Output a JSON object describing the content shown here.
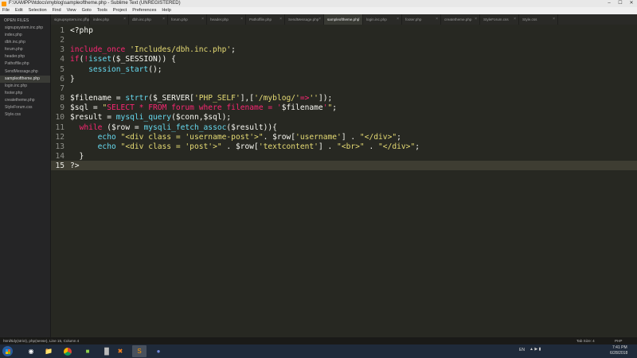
{
  "window": {
    "title": "F:\\XAMPP\\htdocs\\myblog\\sampleoftheme.php - Sublime Text (UNREGISTERED)"
  },
  "menu": [
    "File",
    "Edit",
    "Selection",
    "Find",
    "View",
    "Goto",
    "Tools",
    "Project",
    "Preferences",
    "Help"
  ],
  "sidebar": {
    "header": "OPEN FILES",
    "files": [
      "signupsystem.inc.php",
      "index.php",
      "dbh.inc.php",
      "forum.php",
      "header.php",
      "Pathoffile.php",
      "SendMessage.php",
      "sampleoftheme.php",
      "login.inc.php",
      "footer.php",
      "createtheme.php",
      "StyleForum.css",
      "Style.css"
    ],
    "active_index": 7
  },
  "tabs": [
    "signupsystem.inc.php",
    "index.php",
    "dbh.inc.php",
    "forum.php",
    "header.php",
    "Pathoffile.php",
    "SendMessage.php",
    "sampleoftheme.php",
    "login.inc.php",
    "footer.php",
    "createtheme.php",
    "StyleForum.css",
    "Style.css"
  ],
  "active_tab": 7,
  "editor": {
    "current_line": 15,
    "lines": [
      [
        [
          "<?php",
          "v"
        ]
      ],
      [],
      [
        [
          "include_once",
          "k"
        ],
        [
          " ",
          "v"
        ],
        [
          "'Includes/dbh.inc.php'",
          "s"
        ],
        [
          ";",
          "v"
        ]
      ],
      [
        [
          "if",
          "k"
        ],
        [
          "(",
          "v"
        ],
        [
          "!",
          "k"
        ],
        [
          "isset",
          "f"
        ],
        [
          "($_SESSION)) {",
          "v"
        ]
      ],
      [
        [
          "    ",
          "v"
        ],
        [
          "session_start",
          "f"
        ],
        [
          "();",
          "v"
        ]
      ],
      [
        [
          "}",
          "v"
        ]
      ],
      [],
      [
        [
          "$filename = ",
          "v"
        ],
        [
          "strtr",
          "f"
        ],
        [
          "($_SERVER[",
          "v"
        ],
        [
          "'PHP_SELF'",
          "s"
        ],
        [
          "],[",
          "v"
        ],
        [
          "'/myblog/'",
          "s"
        ],
        [
          "=>",
          "k"
        ],
        [
          "''",
          "s"
        ],
        [
          "]);",
          "v"
        ]
      ],
      [
        [
          "$sql = ",
          "v"
        ],
        [
          "\"",
          "s"
        ],
        [
          "SELECT * FROM forum where filename = '",
          "k"
        ],
        [
          "$filename",
          "v"
        ],
        [
          "'",
          "k"
        ],
        [
          "\"",
          "s"
        ],
        [
          ";",
          "v"
        ]
      ],
      [
        [
          "$result = ",
          "v"
        ],
        [
          "mysqli_query",
          "f"
        ],
        [
          "($conn,$sql);",
          "v"
        ]
      ],
      [
        [
          "  ",
          "v"
        ],
        [
          "while",
          "k"
        ],
        [
          " ($row = ",
          "v"
        ],
        [
          "mysqli_fetch_assoc",
          "f"
        ],
        [
          "($result)){",
          "v"
        ]
      ],
      [
        [
          "      ",
          "v"
        ],
        [
          "echo",
          "f"
        ],
        [
          " ",
          "v"
        ],
        [
          "\"<div class = 'username-post'>\"",
          "s"
        ],
        [
          ". $row[",
          "v"
        ],
        [
          "'username'",
          "s"
        ],
        [
          "] . ",
          "v"
        ],
        [
          "\"</div>\"",
          "s"
        ],
        [
          ";",
          "v"
        ]
      ],
      [
        [
          "      ",
          "v"
        ],
        [
          "echo",
          "f"
        ],
        [
          " ",
          "v"
        ],
        [
          "\"<div class = 'post'>\"",
          "s"
        ],
        [
          " . $row[",
          "v"
        ],
        [
          "'textcontent'",
          "s"
        ],
        [
          "] . ",
          "v"
        ],
        [
          "\"<br>\"",
          "s"
        ],
        [
          " . ",
          "v"
        ],
        [
          "\"</div>\"",
          "s"
        ],
        [
          ";",
          "v"
        ]
      ],
      [
        [
          "  }",
          "v"
        ]
      ],
      [
        [
          "?>",
          "v"
        ]
      ]
    ]
  },
  "status": {
    "left": "html/tidy(strict), php(sense), Line 15, Column 4",
    "tab_size": "Tab Size: 4",
    "syntax": "PHP"
  },
  "taskbar": {
    "lang": "EN",
    "time": "7:41 PM",
    "date": "6/28/2018"
  }
}
